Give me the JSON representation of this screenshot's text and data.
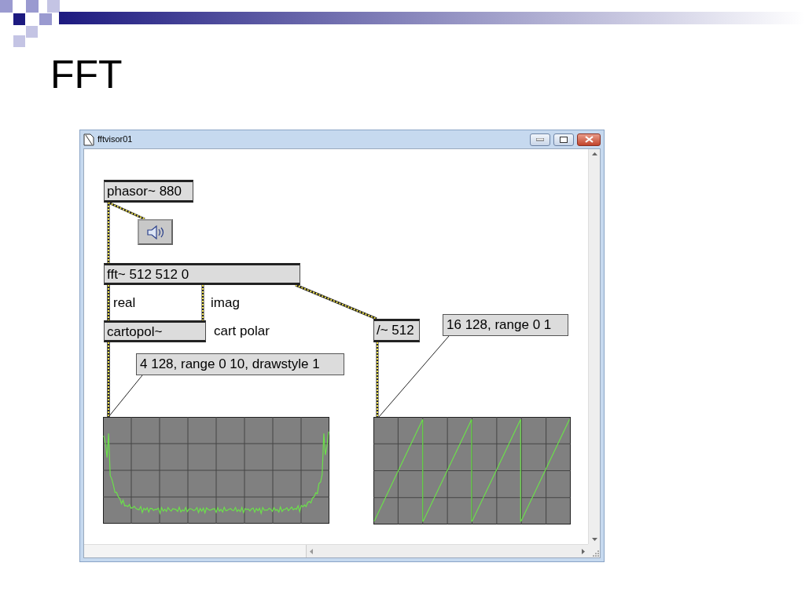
{
  "slide": {
    "title": "FFT"
  },
  "window": {
    "title": "fftvisor01"
  },
  "patch": [
    {
      "kind": "object",
      "text": "phasor~ 880"
    },
    {
      "kind": "speaker"
    },
    {
      "kind": "object",
      "text": "fft~ 512 512 0"
    },
    {
      "kind": "comment",
      "text": "real"
    },
    {
      "kind": "comment",
      "text": "imag"
    },
    {
      "kind": "object",
      "text": "cartopol~"
    },
    {
      "kind": "comment",
      "text": "cart polar"
    },
    {
      "kind": "object",
      "text": "/~ 512"
    },
    {
      "kind": "message",
      "text": "16 128, range 0 1"
    },
    {
      "kind": "message",
      "text": "4 128, range 0 10, drawstyle 1"
    },
    {
      "kind": "spectrum"
    },
    {
      "kind": "sawtooth"
    }
  ]
}
